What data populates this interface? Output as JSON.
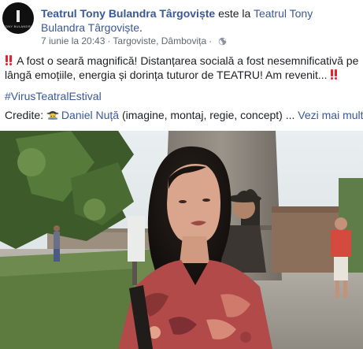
{
  "header": {
    "page_name": "Teatrul Tony Bulandra Târgoviște",
    "verb": " este la ",
    "location_name": "Teatrul Tony Bulandra Târgoviște",
    "period": ".",
    "date": "7 iunie la 20:43",
    "separator": "·",
    "place": "Targoviste, Dâmbovița",
    "privacy_icon": "globe-icon",
    "avatar_text": "TONY BULANDRA"
  },
  "post": {
    "line1": "A fost o seară magnifică! Distanțarea socială a fost nesemnificativă pe lângă emoțiile, energia și dorința tuturor de TEATRU! Am revenit...",
    "hashtag": "#VirusTeatralEstival",
    "credits_label": "Credite: ",
    "credit_name": "Daniel Nuță",
    "credit_roles": " (imagine, montaj, regie, concept) ... ",
    "see_more": "Vezi mai mult",
    "emoji_icon": "double-exclamation-icon",
    "credit_emoji": "detective-icon"
  },
  "video": {
    "icon": "video-player"
  },
  "colors": {
    "link": "#385898",
    "text": "#1c1e21",
    "meta": "#616770",
    "emoji_red": "#e0252f"
  }
}
